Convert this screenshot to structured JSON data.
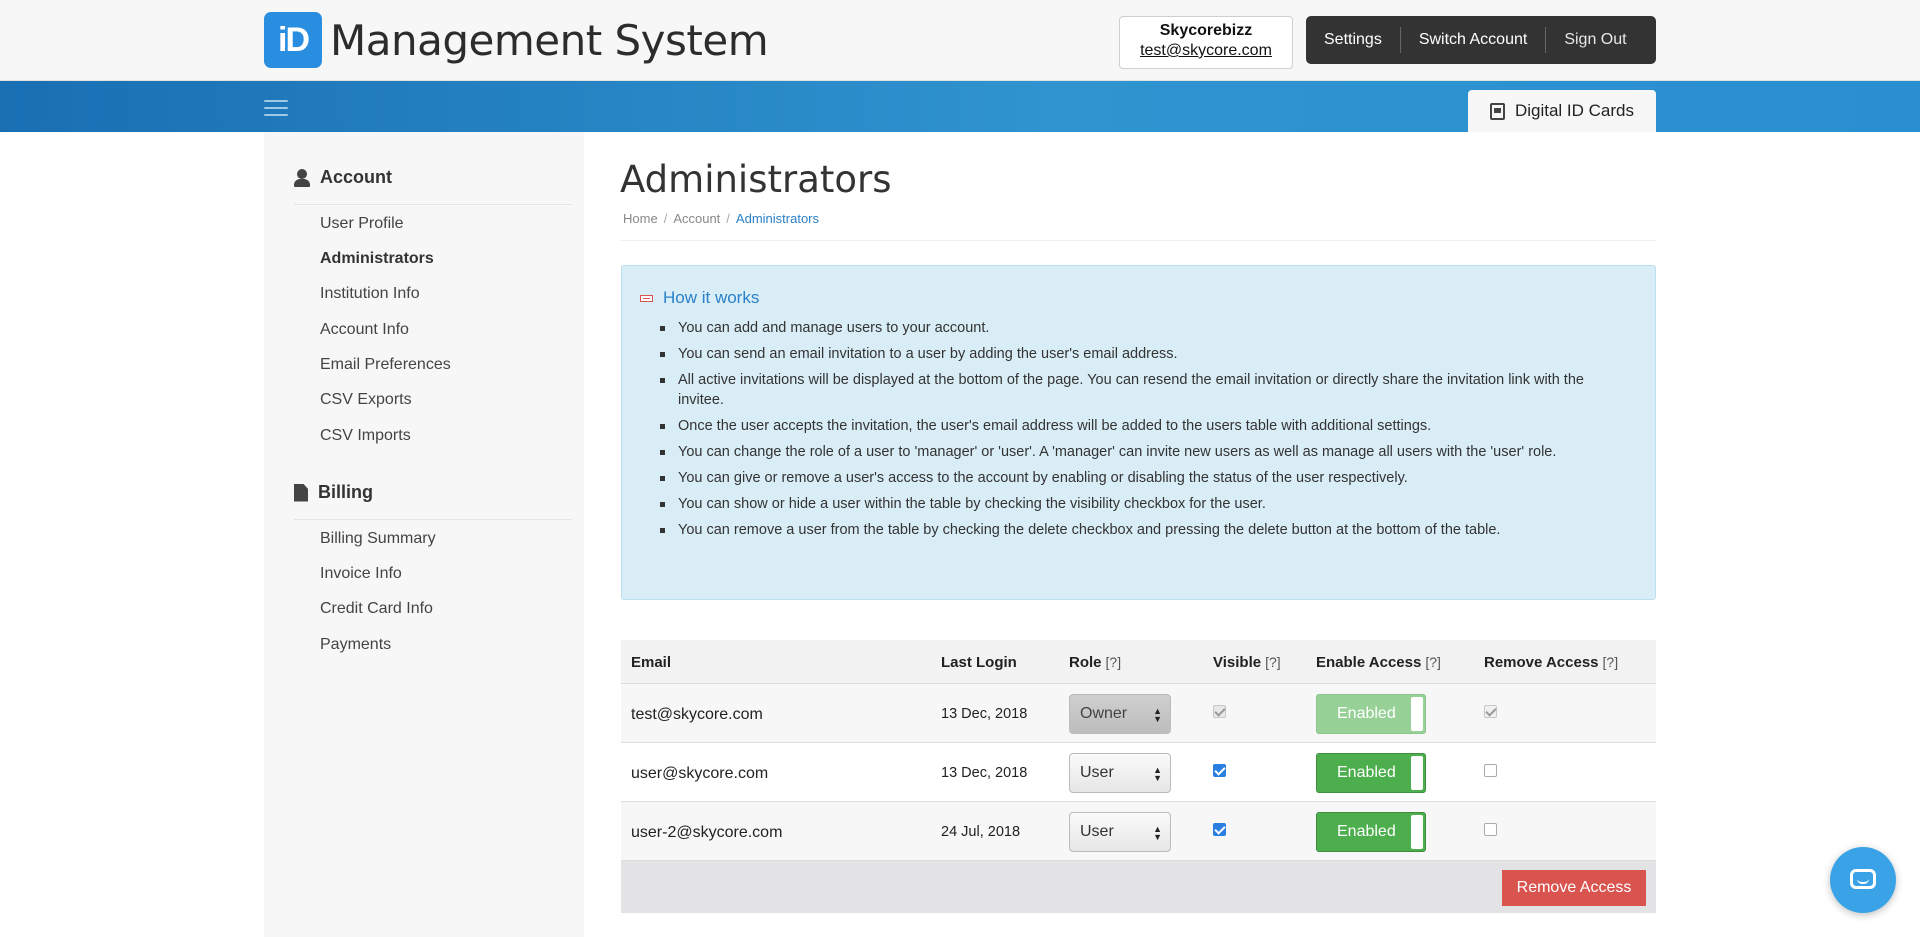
{
  "header": {
    "logo_mark": "iD",
    "app_title": "Management System",
    "account_name": "Skycorebizz",
    "account_email": "test@skycore.com",
    "nav": [
      "Settings",
      "Switch Account",
      "Sign Out"
    ],
    "tab_label": "Digital ID Cards"
  },
  "sidebar": {
    "account_heading": "Account",
    "account_items": [
      "User Profile",
      "Administrators",
      "Institution Info",
      "Account Info",
      "Email Preferences",
      "CSV Exports",
      "CSV Imports"
    ],
    "billing_heading": "Billing",
    "billing_items": [
      "Billing Summary",
      "Invoice Info",
      "Credit Card Info",
      "Payments"
    ]
  },
  "main": {
    "title": "Administrators",
    "breadcrumb": [
      "Home",
      "Account",
      "Administrators"
    ],
    "info_title": "How it works",
    "info_items": [
      "You can add and manage users to your account.",
      "You can send an email invitation to a user by adding the user's email address.",
      "All active invitations will be displayed at the bottom of the page. You can resend the email invitation or directly share the invitation link with the invitee.",
      "Once the user accepts the invitation, the user's email address will be added to the users table with additional settings.",
      "You can change the role of a user to 'manager' or 'user'. A 'manager' can invite new users as well as manage all users with the 'user' role.",
      "You can give or remove a user's access to the account by enabling or disabling the status of the user respectively.",
      "You can show or hide a user within the table by checking the visibility checkbox for the user.",
      "You can remove a user from the table by checking the delete checkbox and pressing the delete button at the bottom of the table."
    ]
  },
  "table": {
    "headers": {
      "email": "Email",
      "last_login": "Last Login",
      "role": "Role",
      "visible": "Visible",
      "enable": "Enable Access",
      "remove": "Remove Access",
      "hint": "[?]"
    },
    "rows": [
      {
        "email": "test@skycore.com",
        "last_login": "13 Dec, 2018",
        "role": "Owner",
        "visible": true,
        "access": "Enabled"
      },
      {
        "email": "user@skycore.com",
        "last_login": "13 Dec, 2018",
        "role": "User",
        "visible": true,
        "access": "Enabled"
      },
      {
        "email": "user-2@skycore.com",
        "last_login": "24 Jul, 2018",
        "role": "User",
        "visible": true,
        "access": "Enabled"
      }
    ],
    "remove_button": "Remove Access"
  },
  "colors": {
    "brand_blue": "#2a8ee0",
    "enabled_green": "#4cae4c",
    "danger_red": "#d9534f",
    "info_bg": "#d9edf7"
  }
}
